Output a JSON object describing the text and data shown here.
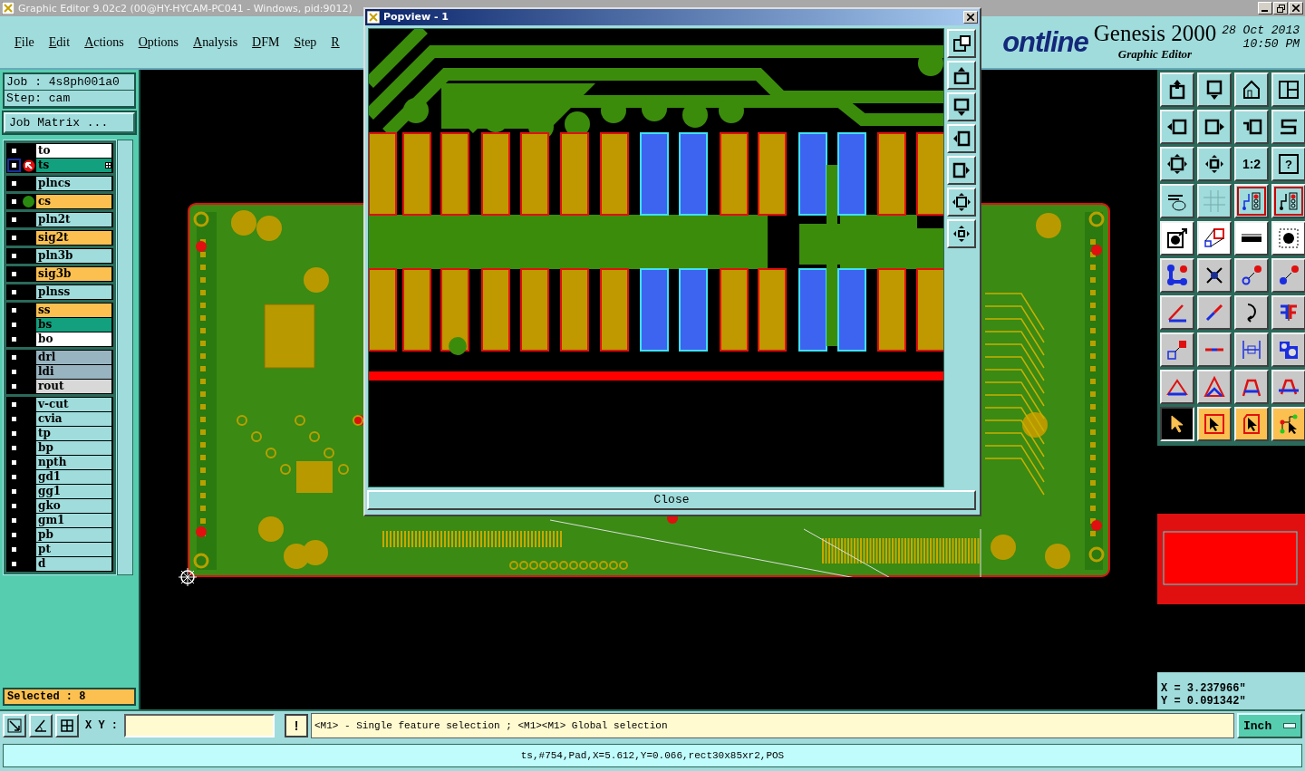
{
  "window": {
    "title": "Graphic Editor 9.02c2 (00@HY-HYCAM-PC041 - Windows, pid:9012)"
  },
  "menu": [
    "File",
    "Edit",
    "Actions",
    "Options",
    "Analysis",
    "DFM",
    "Step",
    "R"
  ],
  "branding": {
    "logo": "ontline",
    "product": "Genesis 2000",
    "subtitle": "Graphic Editor",
    "date": "28 Oct 2013",
    "time": "10:50 PM"
  },
  "job": {
    "job": "Job : 4s8ph001a0",
    "step": "Step: cam",
    "matrix_button": "Job Matrix ..."
  },
  "layer_groups": [
    [
      {
        "name": "to",
        "color": "#ffffff",
        "work": false,
        "displayed": false
      },
      {
        "name": "ts",
        "color": "#12a07e",
        "work": true,
        "displayed": false
      }
    ],
    [
      {
        "name": "plncs",
        "color": "#a0dcdc",
        "work": false,
        "displayed": false
      }
    ],
    [
      {
        "name": "cs",
        "color": "#fcc050",
        "work": false,
        "displayed": true
      }
    ],
    [
      {
        "name": "pln2t",
        "color": "#a0dcdc",
        "work": false,
        "displayed": false
      }
    ],
    [
      {
        "name": "sig2t",
        "color": "#fcc050",
        "work": false,
        "displayed": false
      }
    ],
    [
      {
        "name": "pln3b",
        "color": "#a0dcdc",
        "work": false,
        "displayed": false
      }
    ],
    [
      {
        "name": "sig3b",
        "color": "#fcc050",
        "work": false,
        "displayed": false
      }
    ],
    [
      {
        "name": "plnss",
        "color": "#a0dcdc",
        "work": false,
        "displayed": false
      }
    ],
    [
      {
        "name": "ss",
        "color": "#fcc050",
        "work": false,
        "displayed": false
      },
      {
        "name": "bs",
        "color": "#12a07e",
        "work": false,
        "displayed": false
      },
      {
        "name": "bo",
        "color": "#ffffff",
        "work": false,
        "displayed": false
      }
    ],
    [
      {
        "name": "drl",
        "color": "#98b4c0",
        "work": false,
        "displayed": false
      },
      {
        "name": "ldi",
        "color": "#98b4c0",
        "work": false,
        "displayed": false
      },
      {
        "name": "rout",
        "color": "#d8d8d8",
        "work": false,
        "displayed": false
      }
    ],
    [
      {
        "name": "v-cut",
        "color": "#a0dcdc",
        "work": false,
        "displayed": false
      },
      {
        "name": "cvia",
        "color": "#a0dcdc",
        "work": false,
        "displayed": false
      },
      {
        "name": "tp",
        "color": "#a0dcdc",
        "work": false,
        "displayed": false
      },
      {
        "name": "bp",
        "color": "#a0dcdc",
        "work": false,
        "displayed": false
      },
      {
        "name": "npth",
        "color": "#a0dcdc",
        "work": false,
        "displayed": false
      },
      {
        "name": "gd1",
        "color": "#a0dcdc",
        "work": false,
        "displayed": false
      },
      {
        "name": "gg1",
        "color": "#a0dcdc",
        "work": false,
        "displayed": false
      },
      {
        "name": "gko",
        "color": "#a0dcdc",
        "work": false,
        "displayed": false
      },
      {
        "name": "gm1",
        "color": "#a0dcdc",
        "work": false,
        "displayed": false
      },
      {
        "name": "pb",
        "color": "#a0dcdc",
        "work": false,
        "displayed": false
      },
      {
        "name": "pt",
        "color": "#a0dcdc",
        "work": false,
        "displayed": false
      },
      {
        "name": "d",
        "color": "#a0dcdc",
        "work": false,
        "displayed": false
      }
    ]
  ],
  "selected_count": "Selected : 8",
  "popview": {
    "title": "Popview - 1",
    "close": "Close"
  },
  "toolbar": {
    "ratio_label": "1:2",
    "help_label": "?"
  },
  "selection_tools": [
    {
      "selected": true
    },
    {
      "selected": false
    },
    {
      "selected": false
    },
    {
      "selected": false
    }
  ],
  "coordinates": {
    "x": "X = 3.237966\"",
    "y": "Y = 0.091342\""
  },
  "command_bar": {
    "xy_label": "X Y :",
    "alert_button": "!",
    "prompt": "<M1> - Single feature selection ; <M1><M1> Global selection",
    "units": "Inch"
  },
  "status": "ts,#754,Pad,X=5.612,Y=0.066,rect30x85xr2,POS"
}
